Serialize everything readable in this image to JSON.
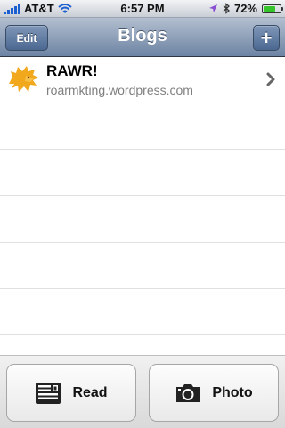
{
  "status_bar": {
    "carrier": "AT&T",
    "time": "6:57 PM",
    "battery": "72%",
    "battery_level": 0.72
  },
  "nav": {
    "title": "Blogs",
    "edit_label": "Edit",
    "add_label": "+"
  },
  "blogs": [
    {
      "name": "RAWR!",
      "url": "roarmkting.wordpress.com"
    }
  ],
  "toolbar": {
    "read_label": "Read",
    "photo_label": "Photo"
  },
  "colors": {
    "nav_gradient_top": "#b3bfd0",
    "nav_gradient_bottom": "#6d84a3",
    "blog_icon": "#f2a81d"
  }
}
